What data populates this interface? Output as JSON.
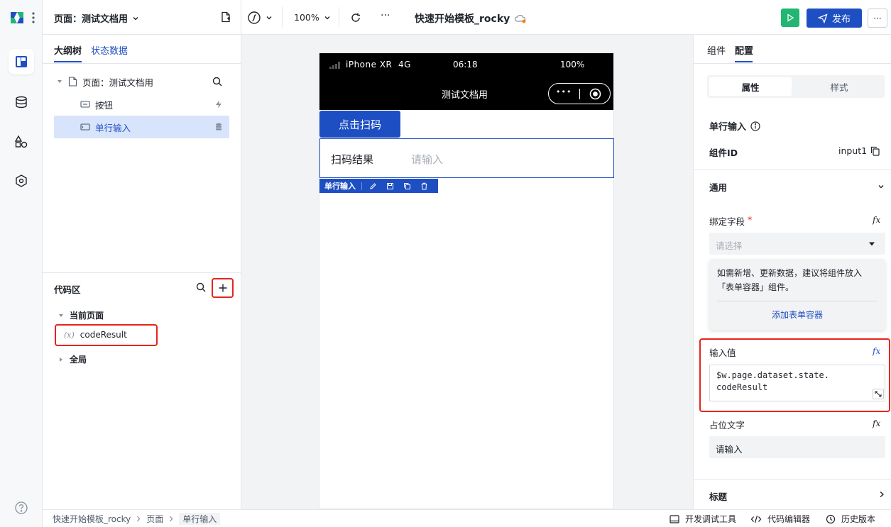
{
  "topbar": {
    "page_selector": "页面：测试文档用",
    "zoom": "100%",
    "more": "···",
    "app_title": "快速开始模板_rocky",
    "publish_label": "发布",
    "more_right": "···"
  },
  "left_panel": {
    "tabs": [
      {
        "label": "大纲树"
      },
      {
        "label": "状态数据"
      }
    ],
    "tree": {
      "page_label": "页面：测试文档用",
      "items": [
        {
          "label": "按钮"
        },
        {
          "label": "单行输入"
        }
      ]
    },
    "code_area": {
      "title": "代码区",
      "sections": [
        {
          "label": "当前页面"
        },
        {
          "label": "全局"
        }
      ],
      "var_symbol": "(𝑥)",
      "var_name": "codeResult"
    }
  },
  "phone": {
    "carrier": "iPhone XR  4G",
    "time": "06:18",
    "battery": "100%",
    "nav_title": "测试文档用",
    "menu_dots": "•••",
    "scan_button": "点击扫码",
    "input_label": "扫码结果",
    "input_placeholder": "请输入",
    "selection_label": "单行输入"
  },
  "right_panel": {
    "tabs": [
      {
        "label": "组件"
      },
      {
        "label": "配置"
      }
    ],
    "segment": [
      {
        "label": "属性"
      },
      {
        "label": "样式"
      }
    ],
    "component_title": "单行输入",
    "component_id_label": "组件ID",
    "component_id_value": "input1",
    "general_section": "通用",
    "bind_field_label": "绑定字段",
    "required_mark": "*",
    "bind_placeholder": "请选择",
    "tip_text": "如需新增、更新数据，建议将组件放入「表单容器」组件。",
    "tip_link": "添加表单容器",
    "input_value_label": "输入值",
    "input_value": "$w.page.dataset.state.\ncodeResult",
    "placeholder_label": "占位文字",
    "placeholder_value": "请输入",
    "title_section": "标题",
    "fx": "fx"
  },
  "statusbar": {
    "breadcrumb": [
      {
        "label": "快速开始模板_rocky"
      },
      {
        "label": "页面"
      },
      {
        "label": "单行输入"
      }
    ],
    "dev_tools": "开发调试工具",
    "code_editor": "代码编辑器",
    "history": "历史版本"
  },
  "colors": {
    "accent": "#1e4fc2",
    "highlight": "#e5251b",
    "run": "#22b573"
  }
}
